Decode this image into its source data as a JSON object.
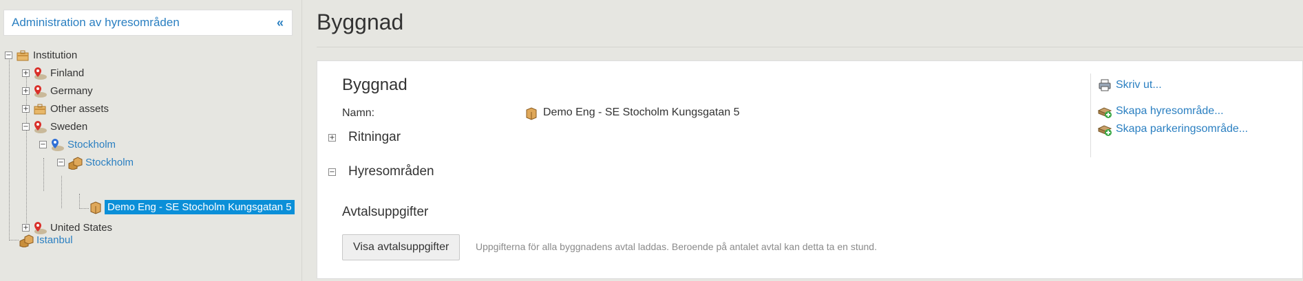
{
  "sidebar": {
    "title": "Administration av hyresområden",
    "collapse_glyph": "«",
    "tree": [
      {
        "label": "Institution",
        "icon": "briefcase-icon",
        "link": false
      },
      {
        "label": "Finland",
        "icon": "map-pin-red-icon",
        "link": false
      },
      {
        "label": "Germany",
        "icon": "map-pin-red-icon",
        "link": false
      },
      {
        "label": "Other assets",
        "icon": "briefcase-icon",
        "link": false
      },
      {
        "label": "Sweden",
        "icon": "map-pin-red-icon",
        "link": false
      },
      {
        "label": "Stockholm",
        "icon": "map-pin-blue-icon",
        "link": true
      },
      {
        "label": "Stockholm",
        "icon": "buildings-icon",
        "link": true
      },
      {
        "label": "Demo Eng - SE Stocholm Kungsgatan 5",
        "icon": "building-icon",
        "link": false,
        "selected": true
      },
      {
        "label": "United States",
        "icon": "map-pin-red-icon",
        "link": false
      },
      {
        "label": "Istanbul",
        "icon": "buildings-icon",
        "link": true
      }
    ]
  },
  "page": {
    "title": "Byggnad"
  },
  "panel": {
    "title": "Byggnad",
    "name_label": "Namn:",
    "name_value": "Demo Eng - SE Stocholm Kungsgatan 5",
    "sections": {
      "drawings": "Ritningar",
      "rental_areas": "Hyresområden"
    },
    "contract_title": "Avtalsuppgifter",
    "show_button": "Visa avtalsuppgifter",
    "hint": "Uppgifterna för alla byggnadens avtal laddas. Beroende på antalet avtal kan detta ta en stund."
  },
  "actions": {
    "print": "Skriv ut...",
    "create_rental_area": "Skapa hyresområde...",
    "create_parking_area": "Skapa parkeringsområde..."
  },
  "colors": {
    "accent": "#2a7fc1",
    "selected": "#0b8fd8",
    "background": "#e6e6e1"
  }
}
